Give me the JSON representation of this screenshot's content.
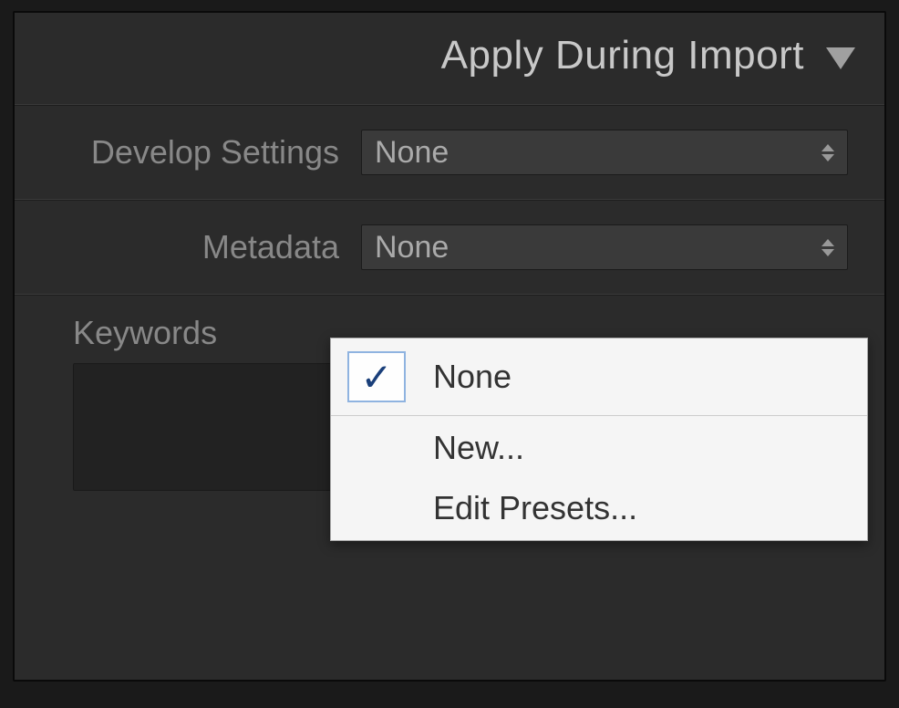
{
  "panel": {
    "title": "Apply During Import"
  },
  "developSettings": {
    "label": "Develop Settings",
    "value": "None"
  },
  "metadata": {
    "label": "Metadata",
    "value": "None"
  },
  "keywords": {
    "label": "Keywords"
  },
  "menu": {
    "items": [
      {
        "label": "None",
        "checked": true
      },
      {
        "label": "New...",
        "checked": false
      },
      {
        "label": "Edit Presets...",
        "checked": false
      }
    ]
  }
}
